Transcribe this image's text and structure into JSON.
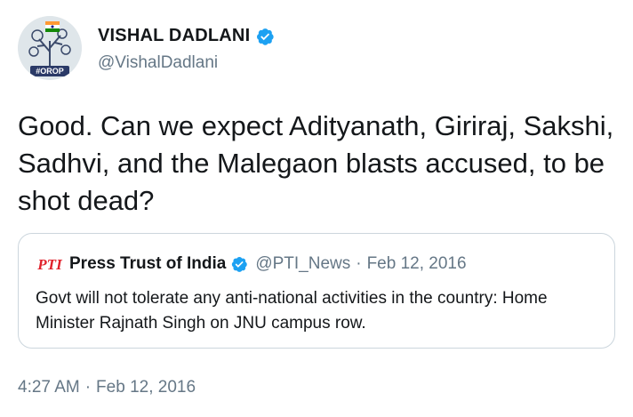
{
  "author": {
    "display_name": "VISHAL DADLANI",
    "handle": "@VishalDadlani",
    "avatar_badge": "#OROP",
    "verified": true
  },
  "tweet": {
    "text": "Good. Can we expect Adityanath, Giriraj, Sakshi, Sadhvi, and the Malegaon blasts accused, to be shot dead?"
  },
  "quoted_tweet": {
    "logo_text": "PTI",
    "display_name": "Press Trust of India",
    "verified": true,
    "handle": "@PTI_News",
    "separator": "·",
    "date": "Feb 12, 2016",
    "text": "Govt will not tolerate any anti-national activities in the country: Home Minister Rajnath Singh on JNU campus row."
  },
  "footer": {
    "time": "4:27 AM",
    "separator": "·",
    "date": "Feb 12, 2016"
  },
  "colors": {
    "text_primary": "#14171a",
    "text_secondary": "#657786",
    "verified_blue": "#1da1f2",
    "border": "#ccd6dd",
    "pti_red": "#e0212b"
  },
  "icons": {
    "verified": "verified-badge-icon",
    "pti": "pti-logo-icon"
  }
}
